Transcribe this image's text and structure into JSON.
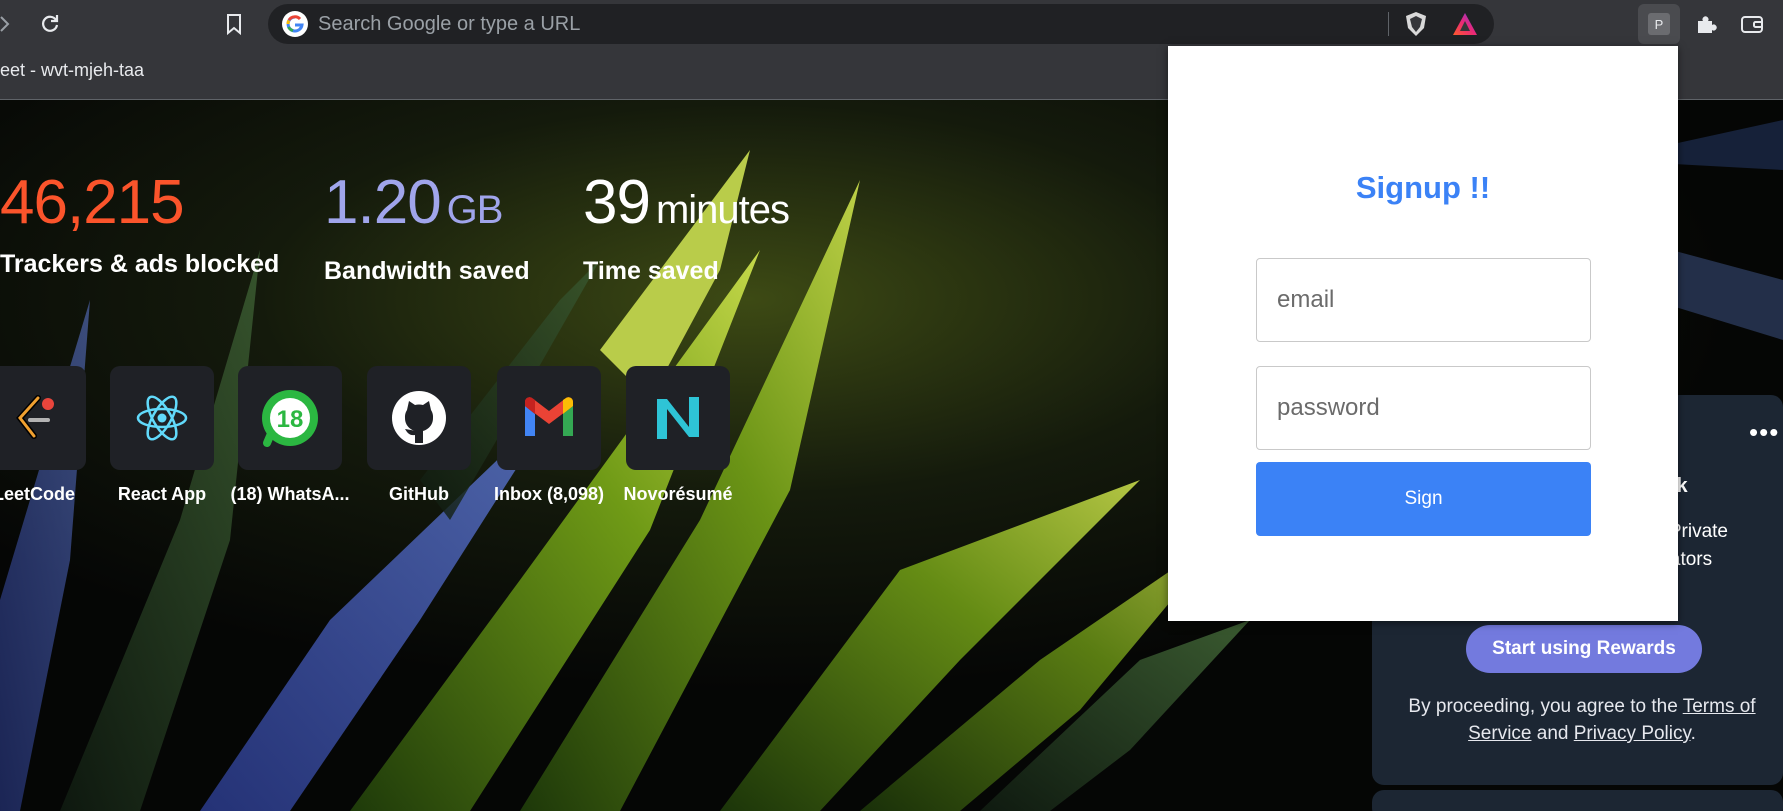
{
  "browser": {
    "omnibox_placeholder": "Search Google or type a URL",
    "tab_fragment": "eet - wvt-mjeh-taa",
    "extension_badge": "P",
    "icons": [
      "forward-icon",
      "reload-icon",
      "bookmark-icon",
      "google-icon",
      "brave-shields-icon",
      "brave-rewards-icon",
      "extension-p-icon",
      "puzzle-icon",
      "wallet-icon"
    ]
  },
  "stats": [
    {
      "number": "46,215",
      "unit": "",
      "label": "Trackers & ads blocked",
      "color": "#fb542b"
    },
    {
      "number": "1.20",
      "unit": "GB",
      "label": "Bandwidth saved",
      "color": "#a0a5eb"
    },
    {
      "number": "39",
      "unit": "minutes",
      "label": "Time saved",
      "color": "#ffffff"
    }
  ],
  "top_sites": [
    {
      "label": "LeetCode",
      "icon": "leetcode-icon"
    },
    {
      "label": "React App",
      "icon": "react-icon"
    },
    {
      "label": "(18) WhatsA...",
      "icon": "whatsapp-icon",
      "badge": "18"
    },
    {
      "label": "GitHub",
      "icon": "github-icon"
    },
    {
      "label": "Inbox (8,098)",
      "icon": "gmail-icon"
    },
    {
      "label": "Novorésumé",
      "icon": "novoresume-icon"
    }
  ],
  "rewards": {
    "more": "•••",
    "title_fragment": "back",
    "desc_line1": "e Private",
    "desc_line2": "reators",
    "button": "Start using Rewards",
    "legal_prefix": "By proceeding, you agree to the ",
    "terms": "Terms of Service",
    "and": " and ",
    "privacy": "Privacy Policy",
    "period": "."
  },
  "popup": {
    "title": "Signup !!",
    "email_placeholder": "email",
    "password_placeholder": "password",
    "submit": "Sign"
  },
  "colors": {
    "toolbar": "#35363a",
    "omnibox": "#202124",
    "accent_blue": "#3b82f6",
    "rewards_button": "#737ade",
    "rewards_card": "#1c2633"
  }
}
